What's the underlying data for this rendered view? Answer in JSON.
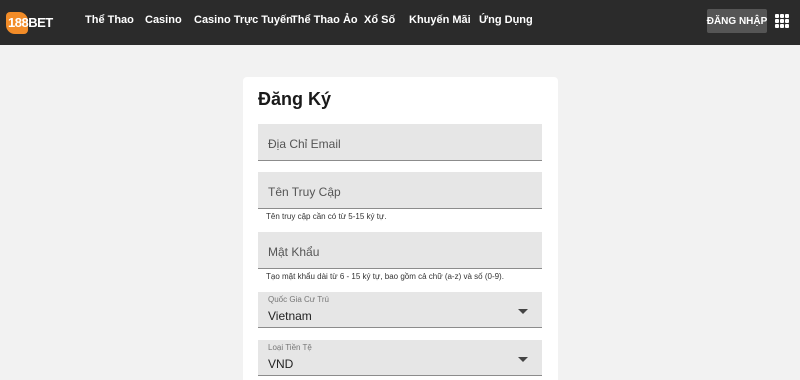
{
  "brand": {
    "logo_number": "188",
    "logo_word": "BET",
    "accent_color": "#f28c28"
  },
  "nav": {
    "items": [
      {
        "label": "Thể Thao"
      },
      {
        "label": "Casino"
      },
      {
        "label": "Casino Trực Tuyến"
      },
      {
        "label": "Thể Thao Ảo"
      },
      {
        "label": "Xổ Số"
      },
      {
        "label": "Khuyến Mãi"
      },
      {
        "label": "Ứng Dụng"
      }
    ],
    "login_label": "ĐĂNG NHẬP",
    "menu_icon": "grid-menu-icon"
  },
  "form": {
    "title": "Đăng Ký",
    "email": {
      "placeholder": "Địa Chỉ Email"
    },
    "username": {
      "placeholder": "Tên Truy Cập",
      "hint": "Tên truy cập cần có từ 5-15 ký tự."
    },
    "password": {
      "placeholder": "Mật Khẩu",
      "hint": "Tạo mật khẩu dài từ 6 - 15 ký tự, bao gồm cả chữ (a-z) và số (0-9)."
    },
    "country": {
      "label": "Quốc Gia Cư Trú",
      "value": "Vietnam"
    },
    "currency": {
      "label": "Loại Tiền Tệ",
      "value": "VND"
    }
  }
}
